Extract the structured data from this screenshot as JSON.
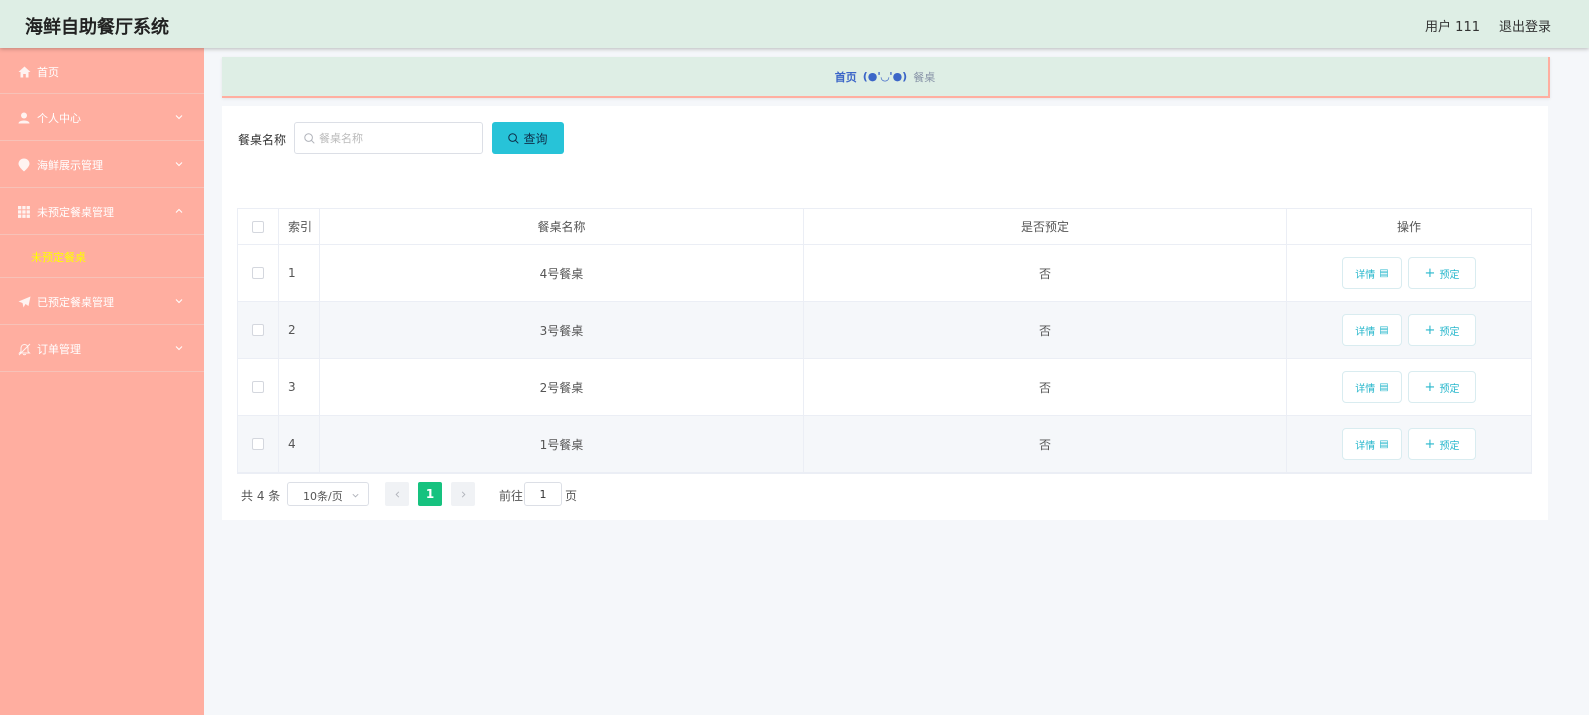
{
  "header": {
    "app_title": "海鲜自助餐厅系统",
    "user_label": "用户 111",
    "logout_label": "退出登录"
  },
  "sidebar": {
    "items": [
      {
        "label": "首页",
        "icon": "home-icon"
      },
      {
        "label": "个人中心",
        "icon": "user-icon"
      },
      {
        "label": "海鲜展示管理",
        "icon": "location-pin-icon"
      },
      {
        "label": "未预定餐桌管理",
        "icon": "grid-icon"
      },
      {
        "label": "未预定餐桌",
        "icon": ""
      },
      {
        "label": "已预定餐桌管理",
        "icon": "send-icon"
      },
      {
        "label": "订单管理",
        "icon": "bell-off-icon"
      }
    ],
    "active_color": "#ffff00",
    "background_color": "#ffaea0"
  },
  "breadcrumb": {
    "home": "首页",
    "separator": "(●'◡'●)",
    "current": "餐桌"
  },
  "search": {
    "label": "餐桌名称",
    "placeholder": "餐桌名称",
    "value": "",
    "button_label": "查询"
  },
  "table": {
    "columns": [
      "索引",
      "餐桌名称",
      "是否预定",
      "操作"
    ],
    "rows": [
      {
        "index": "1",
        "name": "4号餐桌",
        "reserved": "否"
      },
      {
        "index": "2",
        "name": "3号餐桌",
        "reserved": "否"
      },
      {
        "index": "3",
        "name": "2号餐桌",
        "reserved": "否"
      },
      {
        "index": "4",
        "name": "1号餐桌",
        "reserved": "否"
      }
    ],
    "detail_label": "详情",
    "reserve_label": "预定"
  },
  "pagination": {
    "total": "共 4 条",
    "page_size": "10条/页",
    "current_page": "1",
    "goto_label": "前往",
    "goto_value": "1",
    "page_unit": "页"
  },
  "colors": {
    "header_bg": "#deeee5",
    "accent": "#27c3d8",
    "pager_active": "#16c27f"
  }
}
